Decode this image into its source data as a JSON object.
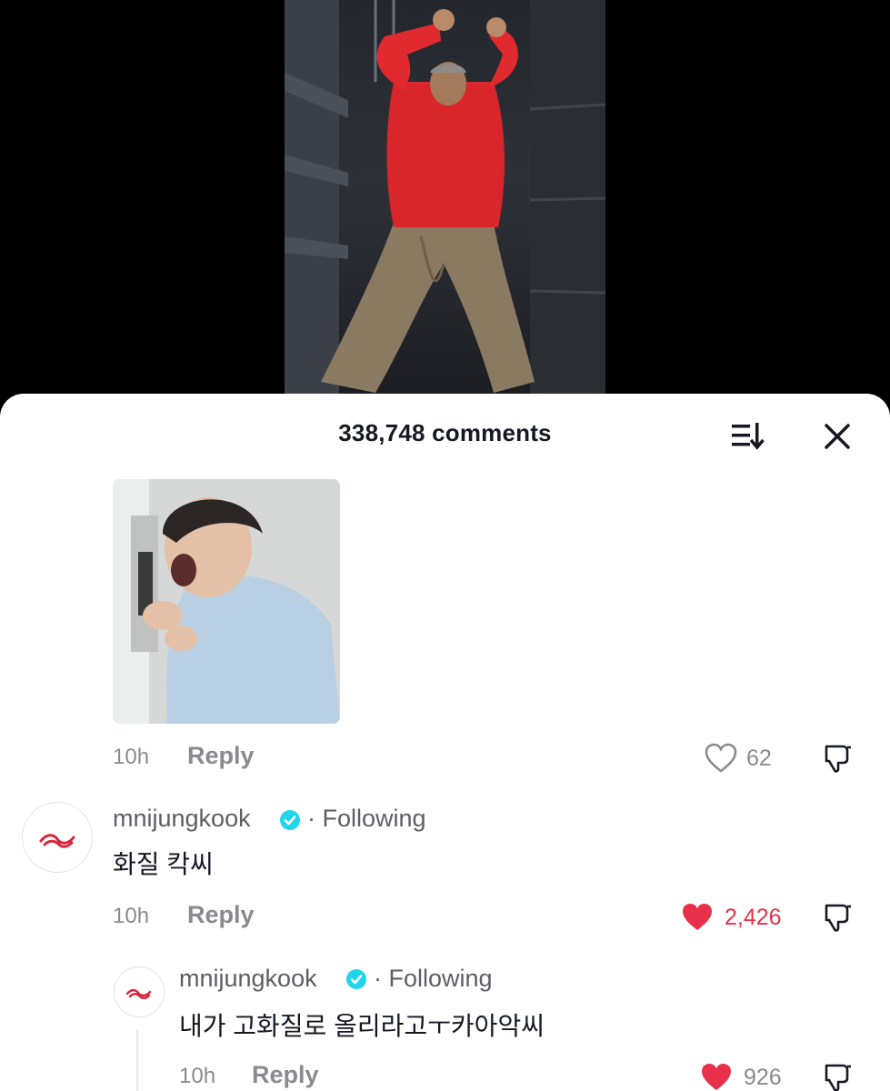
{
  "header": {
    "comment_count_label": "338,748 comments"
  },
  "comments": [
    {
      "type": "sticker",
      "time": "10h",
      "reply_label": "Reply",
      "likes": "62",
      "liked": false
    },
    {
      "username": "mnijungkook",
      "following_label": "· Following",
      "text": "화질 칵씨",
      "time": "10h",
      "reply_label": "Reply",
      "likes": "2,426",
      "liked": true
    },
    {
      "username": "mnijungkook",
      "following_label": "· Following",
      "text": "내가 고화질로 올리라고ㅜ카아악씨",
      "time": "10h",
      "reply_label": "Reply",
      "likes": "926",
      "liked": true
    }
  ],
  "colors": {
    "like_active": "#fe2c55",
    "verified_badge": "#20d5ec",
    "avatar_logo": "#d7263d",
    "secondary_text": "#8a8b91"
  },
  "icons": {
    "sort": "sort-icon",
    "close": "close-icon",
    "like": "heart-icon",
    "dislike": "thumbs-down-icon",
    "verified": "verified-badge-icon"
  }
}
